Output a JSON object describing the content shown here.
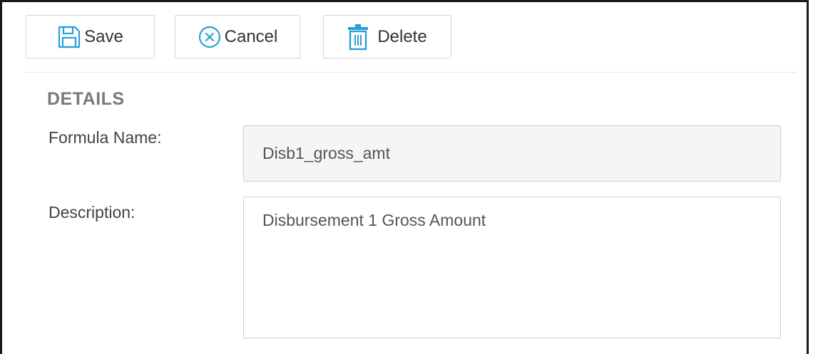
{
  "toolbar": {
    "save_label": "Save",
    "cancel_label": "Cancel",
    "delete_label": "Delete",
    "icon_color": "#2a9fd8"
  },
  "details": {
    "section_title": "DETAILS",
    "formula_name_label": "Formula Name:",
    "formula_name_value": "Disb1_gross_amt",
    "description_label": "Description:",
    "description_value": "Disbursement 1 Gross Amount"
  },
  "icons": {
    "save": "floppy-disk-icon",
    "cancel": "circle-x-icon",
    "delete": "trash-icon"
  }
}
